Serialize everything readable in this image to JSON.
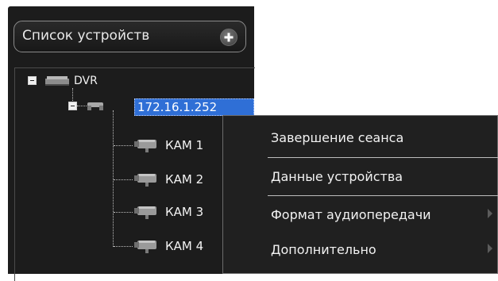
{
  "panel": {
    "title": "Список устройств",
    "add_icon": "plus-circle-icon"
  },
  "tree": {
    "dvr": {
      "label": "DVR",
      "icon": "dvr-device-icon",
      "expanded": true
    },
    "device": {
      "label": "172.16.1.252",
      "icon": "network-device-icon",
      "selected": true,
      "expanded": true
    },
    "cameras": [
      {
        "label": "КАМ 1",
        "icon": "camera-icon"
      },
      {
        "label": "КАМ 2",
        "icon": "camera-icon"
      },
      {
        "label": "КАМ 3",
        "icon": "camera-icon"
      },
      {
        "label": "КАМ 4",
        "icon": "camera-icon"
      }
    ]
  },
  "context_menu": {
    "items": [
      {
        "label": "Завершение сеанса",
        "submenu": false
      },
      {
        "label": "Данные устройства",
        "submenu": false
      },
      {
        "label": "Формат аудиопередачи",
        "submenu": true
      },
      {
        "label": "Дополнительно",
        "submenu": true
      }
    ]
  },
  "colors": {
    "panel_bg": "#1c1c1c",
    "selection": "#2f6fd6",
    "text": "#f2f2f2"
  }
}
